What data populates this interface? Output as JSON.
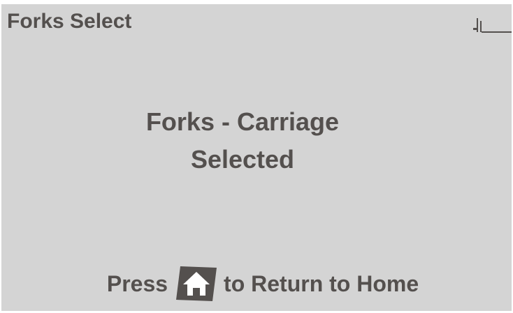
{
  "header": {
    "title": "Forks Select",
    "status_icon": "mast-fork-icon"
  },
  "message": {
    "line1": "Forks - Carriage",
    "line2": "Selected"
  },
  "footer": {
    "prefix": "Press",
    "home_icon": "home-icon",
    "suffix": "to Return to Home"
  },
  "colors": {
    "screen_background": "#d4d4d4",
    "text": "#54504e",
    "button": "#54504e",
    "icon_foreground": "#ffffff"
  }
}
